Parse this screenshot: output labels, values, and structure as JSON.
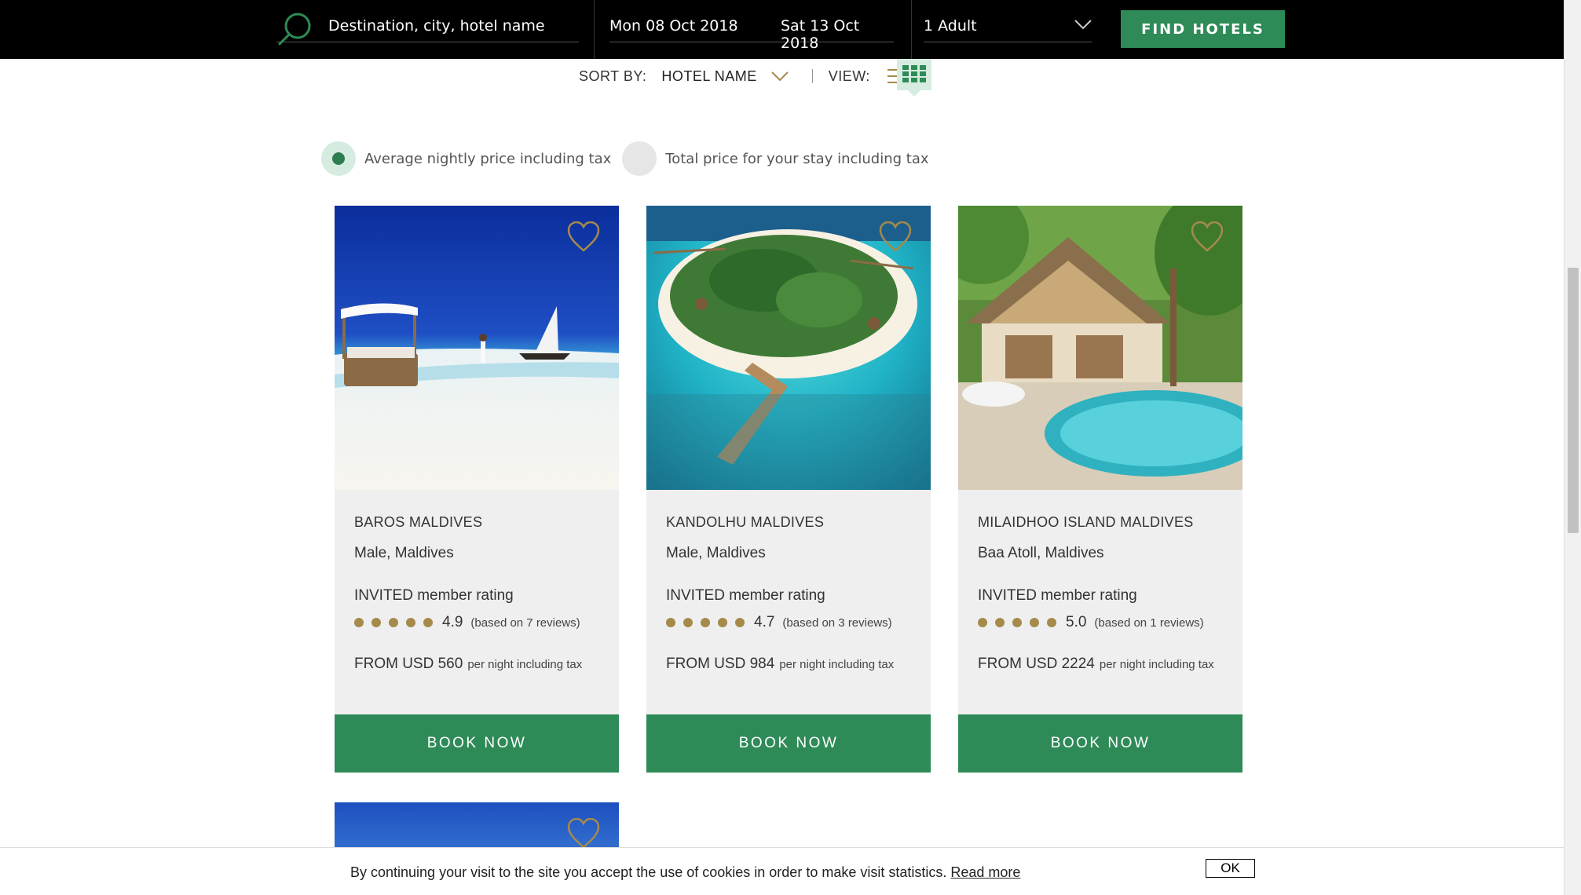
{
  "topbar": {
    "search_placeholder": "Destination, city, hotel name",
    "checkin": "Mon 08 Oct 2018",
    "checkout": "Sat 13 Oct 2018",
    "guests": "1 Adult",
    "find_label": "FIND HOTELS",
    "accent_color": "#2e8b57"
  },
  "sortbar": {
    "sort_label": "SORT BY:",
    "sort_value": "HOTEL NAME",
    "view_label": "VIEW:",
    "active_view": "grid"
  },
  "price_mode": {
    "option_1": "Average nightly price including tax",
    "option_2": "Total price for your stay including tax",
    "selected": "option_1"
  },
  "hotels": [
    {
      "name": "BAROS MALDIVES",
      "location": "Male, Maldives",
      "rating_label": "INVITED member rating",
      "score": "4.9",
      "reviews": "(based on 7 reviews)",
      "price": "FROM USD 560",
      "price_suffix": "per night including tax",
      "book_label": "BOOK NOW"
    },
    {
      "name": "KANDOLHU MALDIVES",
      "location": "Male, Maldives",
      "rating_label": "INVITED member rating",
      "score": "4.7",
      "reviews": "(based on 3 reviews)",
      "price": "FROM USD 984",
      "price_suffix": "per night including tax",
      "book_label": "BOOK NOW"
    },
    {
      "name": "MILAIDHOO ISLAND MALDIVES",
      "location": "Baa Atoll, Maldives",
      "rating_label": "INVITED member rating",
      "score": "5.0",
      "reviews": "(based on 1 reviews)",
      "price": "FROM USD 2224",
      "price_suffix": "per night including tax",
      "book_label": "BOOK NOW"
    }
  ],
  "cookie": {
    "text": "By continuing your visit to the site you accept the use of cookies in order to make visit statistics.",
    "link": "Read more",
    "ok": "OK"
  }
}
